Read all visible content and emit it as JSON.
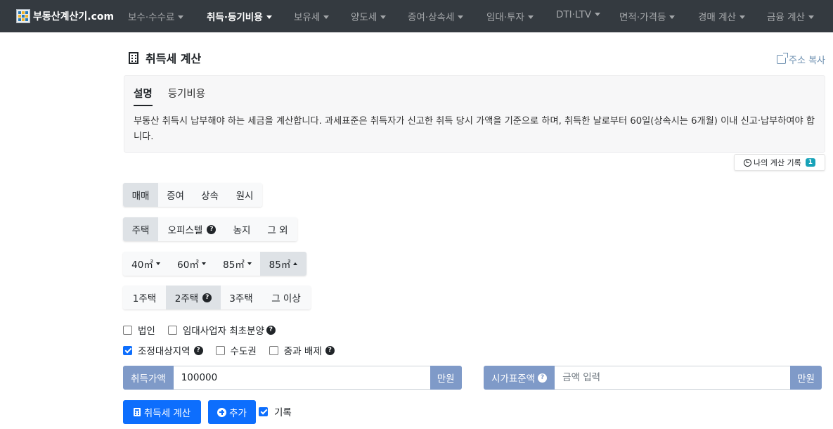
{
  "navbar": {
    "brand": "부동산계산기.com",
    "items": [
      {
        "label": "보수·수수료"
      },
      {
        "label": "취득·등기비용"
      },
      {
        "label": "보유세"
      },
      {
        "label": "양도세"
      },
      {
        "label": "증여·상속세"
      },
      {
        "label": "임대·투자"
      },
      {
        "label": "DTI·LTV"
      },
      {
        "label": "면적·가격등"
      },
      {
        "label": "경매 계산"
      },
      {
        "label": "금융 계산"
      }
    ],
    "active_index": 1
  },
  "page": {
    "title": "취득세 계산",
    "share_label": "주소 복사"
  },
  "info": {
    "tabs": [
      {
        "label": "설명"
      },
      {
        "label": "등기비용"
      }
    ],
    "description": "부동산 취득시 납부해야 하는 세금을 계산합니다. 과세표준은 취득자가 신고한 취득 당시 가액을 기준으로 하며, 취득한 날로부터 60일(상속시는 6개월) 이내 신고·납부하여야 합니다."
  },
  "history": {
    "label": "나의 계산 기록",
    "count": "1"
  },
  "acquisition_type": {
    "options": [
      {
        "label": "매매"
      },
      {
        "label": "증여"
      },
      {
        "label": "상속"
      },
      {
        "label": "원시"
      }
    ],
    "selected": "매매"
  },
  "property_type": {
    "options": [
      {
        "label": "주택"
      },
      {
        "label": "오피스텔"
      },
      {
        "label": "농지"
      },
      {
        "label": "그 외"
      }
    ],
    "selected": "주택"
  },
  "area": {
    "options": [
      {
        "label": "40㎡"
      },
      {
        "label": "60㎡"
      },
      {
        "label": "85㎡"
      },
      {
        "label": "85㎡"
      }
    ],
    "selected_index": 3
  },
  "house_count": {
    "options": [
      {
        "label": "1주택"
      },
      {
        "label": "2주택"
      },
      {
        "label": "3주택"
      },
      {
        "label": "그 이상"
      }
    ],
    "selected": "2주택"
  },
  "checkboxes": {
    "corporation": {
      "label": "법인",
      "checked": false
    },
    "rental_business": {
      "label": "임대사업자 최초분양",
      "checked": false
    },
    "adjusted_area": {
      "label": "조정대상지역",
      "checked": true
    },
    "capital_area": {
      "label": "수도권",
      "checked": false
    },
    "heavy_exclusion": {
      "label": "중과 배제",
      "checked": false
    }
  },
  "inputs": {
    "acquisition_price": {
      "label": "취득가액",
      "value": "100000",
      "unit": "만원"
    },
    "standard_price": {
      "label": "시가표준액",
      "placeholder": "금액 입력",
      "unit": "만원"
    }
  },
  "actions": {
    "calculate_label": "취득세 계산",
    "add_label": "추가",
    "record_label": "기록",
    "record_checked": true
  },
  "colors": {
    "navbar_bg": "#343a40",
    "primary": "#0d6efd",
    "input_addon": "#7f9ac8",
    "badge": "#17a2b8"
  },
  "icons": {
    "title": "building-icon",
    "share": "share-icon",
    "history": "history-icon",
    "help": "question-circle-icon",
    "calculate": "calculator-icon",
    "add": "plus-circle-icon"
  }
}
